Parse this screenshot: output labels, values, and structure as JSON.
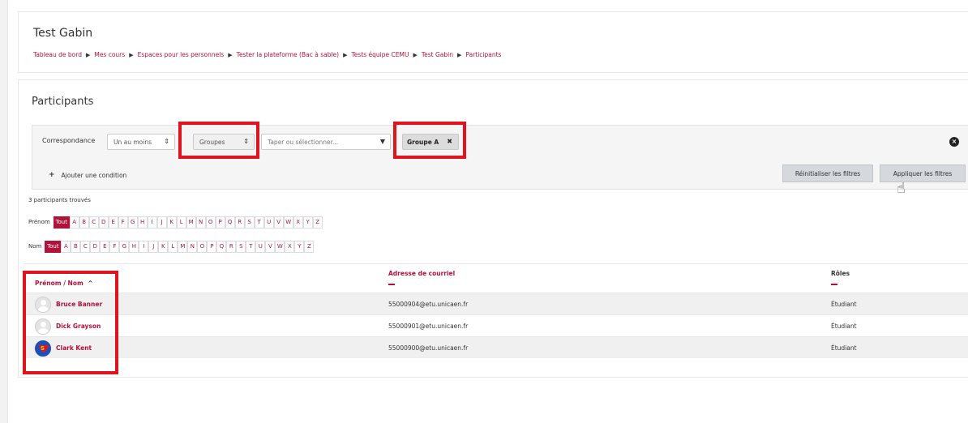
{
  "header": {
    "title": "Test Gabin",
    "breadcrumb": [
      "Tableau de bord",
      "Mes cours",
      "Espaces pour les personnels",
      "Tester la plateforme (Bac à sable)",
      "Tests équipe CEMU",
      "Test Gabin",
      "Participants"
    ],
    "separator": "▶"
  },
  "participants": {
    "title": "Participants",
    "filters": {
      "match_label": "Correspondance",
      "match_value": "Un au moins",
      "type_value": "Groupes",
      "search_placeholder": "Taper ou sélectionner...",
      "selected_tag": "Groupe A",
      "tag_remove": "✖",
      "add_condition": "Ajouter une condition",
      "reset_label": "Réinitialiser les filtres",
      "apply_label": "Appliquer les filtres"
    },
    "count_text": "3 participants trouvés",
    "firstname_label": "Prénom",
    "lastname_label": "Nom",
    "all_label": "Tout",
    "letters": [
      "A",
      "B",
      "C",
      "D",
      "E",
      "F",
      "G",
      "H",
      "I",
      "J",
      "K",
      "L",
      "M",
      "N",
      "O",
      "P",
      "Q",
      "R",
      "S",
      "T",
      "U",
      "V",
      "W",
      "X",
      "Y",
      "Z"
    ],
    "columns": {
      "name": "Prénom / Nom",
      "email": "Adresse de courriel",
      "roles": "Rôles"
    },
    "rows": [
      {
        "name": "Bruce Banner",
        "email": "55000904@etu.unicaen.fr",
        "role": "Étudiant",
        "avatar": "default-avatar-icon"
      },
      {
        "name": "Dick Grayson",
        "email": "55000901@etu.unicaen.fr",
        "role": "Étudiant",
        "avatar": "default-avatar-icon"
      },
      {
        "name": "Clark Kent",
        "email": "55000900@etu.unicaen.fr",
        "role": "Étudiant",
        "avatar": "superman-avatar-icon"
      }
    ]
  },
  "colors": {
    "accent": "#b0123a",
    "highlight": "#e0141e"
  }
}
